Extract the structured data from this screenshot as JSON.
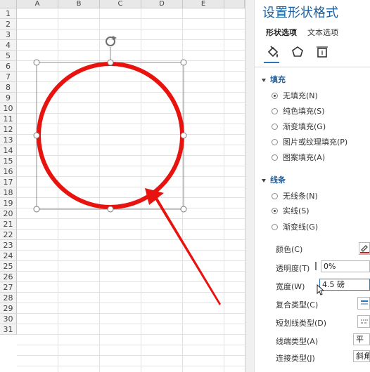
{
  "spreadsheet": {
    "columns": [
      "A",
      "B",
      "C",
      "D",
      "E"
    ],
    "rows": [
      "1",
      "2",
      "3",
      "4",
      "5",
      "6",
      "7",
      "8",
      "9",
      "10",
      "11",
      "12",
      "13",
      "14",
      "15",
      "16",
      "17",
      "18",
      "19",
      "20",
      "21",
      "22",
      "23",
      "24",
      "25",
      "26",
      "27",
      "28",
      "29",
      "30",
      "31"
    ]
  },
  "shape": {
    "stroke_color": "#e8130f",
    "arrow_color": "#e8130f"
  },
  "pane": {
    "title": "设置形状格式",
    "tabs": {
      "shape_options": "形状选项",
      "text_options": "文本选项"
    },
    "icons": [
      "paint-bucket-icon",
      "pentagon-icon",
      "size-properties-icon"
    ],
    "fill": {
      "header": "填充",
      "options": [
        "无填充(N)",
        "纯色填充(S)",
        "渐变填充(G)",
        "图片或纹理填充(P)",
        "图案填充(A)"
      ],
      "selected": "无填充(N)"
    },
    "line": {
      "header": "线条",
      "options": [
        "无线条(N)",
        "实线(S)",
        "渐变线(G)"
      ],
      "selected": "实线(S)",
      "color_label": "颜色(C)",
      "color_value": "#e8130f",
      "transparency_label": "透明度(T)",
      "transparency_value": "0%",
      "width_label": "宽度(W)",
      "width_value": "4.5 磅",
      "compound_label": "复合类型(C)",
      "dash_label": "短划线类型(D)",
      "cap_label": "线端类型(A)",
      "cap_value": "平",
      "join_label": "连接类型(J)",
      "join_value": "斜角"
    }
  }
}
